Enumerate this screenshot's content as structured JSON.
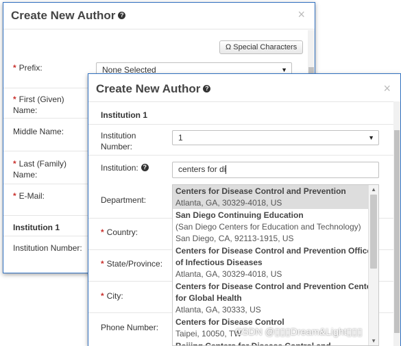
{
  "back_dialog": {
    "title": "Create New Author",
    "close_glyph": "×",
    "special_chars_button": "Ω Special Characters",
    "fields": {
      "prefix": "Prefix:",
      "prefix_value": "None Selected",
      "first_name": "First (Given) Name:",
      "middle_name": "Middle Name:",
      "last_name": "Last (Family) Name:",
      "email": "E-Mail:"
    },
    "section_institution": "Institution 1",
    "institution_number": "Institution Number:"
  },
  "front_dialog": {
    "title": "Create New Author",
    "close_glyph": "×",
    "section_institution": "Institution 1",
    "fields": {
      "institution_number_label": "Institution Number:",
      "institution_number_value": "1",
      "institution_label": "Institution:",
      "institution_value": "centers for di",
      "department": "Department:",
      "country": "Country:",
      "state_province": "State/Province:",
      "city": "City:",
      "phone_number": "Phone Number:"
    }
  },
  "autocomplete": {
    "items": [
      {
        "name": "Centers for Disease Control and Prevention",
        "lines": [
          "Atlanta, GA, 30329-4018, US"
        ],
        "selected": true
      },
      {
        "name": "San Diego Continuing Education",
        "lines": [
          "(San Diego Centers for Education and Technology)",
          "San Diego, CA, 92113-1915, US"
        ],
        "selected": false
      },
      {
        "name": "Centers for Disease Control and Prevention Office of Infectious Diseases",
        "lines": [
          "Atlanta, GA, 30329-4018, US"
        ],
        "selected": false
      },
      {
        "name": "Centers for Disease Control and Prevention Center for Global Health",
        "lines": [
          "Atlanta, GA, 30333, US"
        ],
        "selected": false
      },
      {
        "name": "Centers for Disease Control",
        "lines": [
          "Taipei, 10050, TW"
        ],
        "selected": false
      },
      {
        "name": "Beijing Centers for Disease Control and",
        "lines": [],
        "selected": false
      }
    ]
  },
  "watermark": "CSDN @▯▯▯Dream&Light▯▯▯",
  "colors": {
    "dialog_border": "#2f6fbf",
    "required_star": "#c9302c",
    "selected_row": "#dddddd"
  }
}
